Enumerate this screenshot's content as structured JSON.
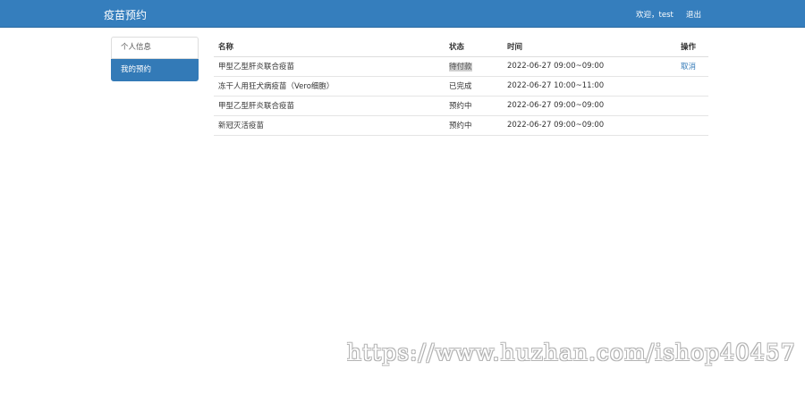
{
  "header": {
    "brand": "疫苗预约",
    "welcome": "欢迎，test",
    "logout": "退出"
  },
  "sidebar": {
    "items": [
      {
        "label": "个人信息",
        "active": false
      },
      {
        "label": "我的预约",
        "active": true
      }
    ]
  },
  "table": {
    "columns": [
      "名称",
      "状态",
      "时间",
      "操作"
    ],
    "rows": [
      {
        "name": "甲型乙型肝炎联合疫苗",
        "status": "待付款",
        "time": "2022-06-27 09:00~09:00",
        "action": "取消"
      },
      {
        "name": "冻干人用狂犬病疫苗（Vero细胞）",
        "status": "已完成",
        "time": "2022-06-27 10:00~11:00",
        "action": ""
      },
      {
        "name": "甲型乙型肝炎联合疫苗",
        "status": "预约中",
        "time": "2022-06-27 09:00~09:00",
        "action": ""
      },
      {
        "name": "新冠灭活疫苗",
        "status": "预约中",
        "time": "2022-06-27 09:00~09:00",
        "action": ""
      }
    ]
  },
  "watermark": "https://www.huzhan.com/ishop40457",
  "colors": {
    "navbar": "#357ebd",
    "active_item": "#337ab7",
    "link": "#337ab7"
  }
}
